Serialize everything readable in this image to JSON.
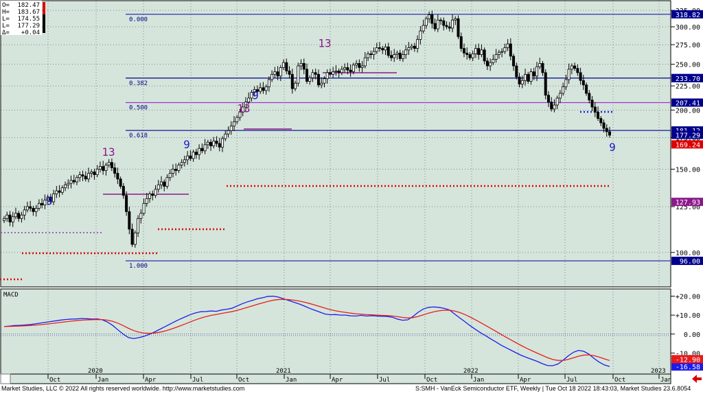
{
  "chart_data": [
    {
      "type": "candlestick",
      "ylim": [
        86,
        335
      ],
      "yscale": "log",
      "price_ticks": [
        100,
        125,
        150,
        175,
        200,
        225,
        250,
        275,
        300,
        325
      ],
      "x_months": [
        "Oct",
        "Jan",
        "Apr",
        "Jul",
        "Oct",
        "Jan",
        "Apr",
        "Jul",
        "Oct",
        "Jan",
        "Apr",
        "Jul",
        "Oct",
        "Jan"
      ],
      "x_years": [
        "2020",
        "2021",
        "2022",
        "2023"
      ],
      "ohlc_readout": [
        {
          "label": "O=",
          "value": "182.47"
        },
        {
          "label": "H=",
          "value": "183.67"
        },
        {
          "label": "L=",
          "value": "174.55"
        },
        {
          "label": "L=",
          "value": "177.29"
        },
        {
          "label": "Δ=",
          "value": "+0.04"
        }
      ],
      "fib_levels": [
        {
          "label": "0.000",
          "price": 318.82,
          "badge": "318.82"
        },
        {
          "label": "0.382",
          "price": 233.7,
          "badge": "233.70"
        },
        {
          "label": "0.500",
          "price": 207.41,
          "badge": "207.41"
        },
        {
          "label": "0.618",
          "price": 181.12,
          "badge": "181.12"
        },
        {
          "label": "1.000",
          "price": 96.0,
          "badge": "96.00"
        }
      ],
      "price_badges": [
        {
          "label": "177.29",
          "price": 177.29,
          "color": "#00008b"
        },
        {
          "label": "169.24",
          "price": 169.24,
          "color": "#dd0000"
        },
        {
          "label": "127.93",
          "price": 127.93,
          "color": "#8b1a8b"
        },
        {
          "label": "233.70",
          "price": 233.7,
          "color": "#00008b"
        }
      ],
      "close_series": [
        118,
        120,
        116,
        119,
        121,
        118,
        120,
        123,
        125,
        124,
        122,
        124,
        127,
        126,
        129,
        131,
        128,
        133,
        135,
        134,
        137,
        139,
        140,
        142,
        141,
        144,
        146,
        145,
        143,
        147,
        148,
        146,
        150,
        152,
        149,
        153,
        155,
        151,
        147,
        143,
        138,
        132,
        122,
        112,
        104,
        110,
        118,
        121,
        127,
        130,
        133,
        132,
        136,
        139,
        141,
        138,
        144,
        147,
        150,
        149,
        153,
        155,
        157,
        160,
        158,
        163,
        161,
        166,
        164,
        169,
        171,
        168,
        172,
        170,
        167,
        174,
        178,
        181,
        185,
        189,
        193,
        198,
        203,
        208,
        212,
        218,
        221,
        219,
        223,
        220,
        224,
        232,
        238,
        241,
        236,
        246,
        252,
        242,
        238,
        222,
        228,
        248,
        251,
        244,
        230,
        234,
        240,
        238,
        226,
        228,
        233,
        240,
        238,
        241,
        242,
        240,
        244,
        246,
        243,
        241,
        249,
        251,
        246,
        248,
        258,
        263,
        262,
        266,
        271,
        270,
        268,
        272,
        261,
        258,
        262,
        264,
        257,
        262,
        268,
        271,
        273,
        270,
        282,
        294,
        302,
        312,
        318,
        305,
        297,
        310,
        309,
        302,
        300,
        298,
        310,
        312,
        286,
        270,
        264,
        262,
        258,
        263,
        270,
        262,
        268,
        254,
        248,
        252,
        256,
        262,
        265,
        266,
        271,
        276,
        260,
        248,
        235,
        227,
        231,
        238,
        230,
        241,
        236,
        247,
        251,
        240,
        215,
        208,
        201,
        205,
        212,
        217,
        224,
        232,
        244,
        248,
        245,
        240,
        231,
        226,
        217,
        210,
        203,
        198,
        192,
        188,
        183,
        180,
        177
      ],
      "signals": [
        {
          "text": "13",
          "price": 160,
          "color": "#8b1a8b"
        },
        {
          "text": "9",
          "price": 126,
          "color": "#1c1cc8"
        },
        {
          "text": "9",
          "price": 166,
          "color": "#1c1cc8"
        },
        {
          "text": "13",
          "price": 198,
          "color": "#8b1a8b"
        },
        {
          "text": "9",
          "price": 211,
          "color": "#1c1cc8"
        },
        {
          "text": "13",
          "price": 272,
          "color": "#8b1a8b"
        },
        {
          "text": "9",
          "price": 164,
          "color": "#1c1cc8"
        }
      ]
    },
    {
      "type": "line",
      "title": "MACD",
      "ylim": [
        -20,
        22
      ],
      "yticks": [
        "+20.00",
        "+10.00",
        "0.00",
        "-10.00"
      ],
      "macd_line_color": "#1c1ce8",
      "signal_line_color": "#e81c1c",
      "macd_badge": "-16.58",
      "signal_badge": "-12.90",
      "macd": [
        4,
        4.2,
        4.5,
        4.6,
        4.8,
        5,
        5.4,
        5.8,
        6.2,
        6.6,
        7,
        7.4,
        7.7,
        7.9,
        8,
        8.2,
        8.1,
        7.9,
        8,
        7.5,
        6.3,
        4.5,
        2.2,
        0,
        -1.8,
        -2.4,
        -1.9,
        -1.2,
        -0.2,
        1,
        2.4,
        3.8,
        5.2,
        6.6,
        7.9,
        9.1,
        10.3,
        11.2,
        11.8,
        11.9,
        12.2,
        12,
        12.7,
        13.1,
        13.6,
        14.8,
        16,
        17,
        17.8,
        18.7,
        19.2,
        19.9,
        20,
        19.5,
        18.6,
        17.7,
        16.8,
        15.9,
        14.8,
        13.6,
        12.6,
        11.6,
        10.6,
        10.2,
        10.3,
        10,
        10,
        9.6,
        9.5,
        9.9,
        9.5,
        9.7,
        9.5,
        9.4,
        9.3,
        8.9,
        7.9,
        7.3,
        7.5,
        9.3,
        11.5,
        13.2,
        14.1,
        14.3,
        14.1,
        13.6,
        12.8,
        10.7,
        8.6,
        6.6,
        4.5,
        2.6,
        0.8,
        -0.8,
        -2.5,
        -4.1,
        -5.8,
        -7.2,
        -8.6,
        -10,
        -11.3,
        -12.4,
        -13.4,
        -14.4,
        -15.6,
        -16.6,
        -16.7,
        -15.8,
        -13.8,
        -11.5,
        -9.6,
        -8.6,
        -9.1,
        -10.6,
        -12.9,
        -14.8,
        -16.3,
        -17.1
      ]
    }
  ],
  "footer": {
    "left": "Market Studies, LLC © 2022 All rights reserved worldwide. http://www.marketstudies.com",
    "right": "S:SMH - VanEck Semiconductor ETF, Weekly | Tue Oct 18 2022 18:43:03, Market Studies 23.6.8054"
  }
}
